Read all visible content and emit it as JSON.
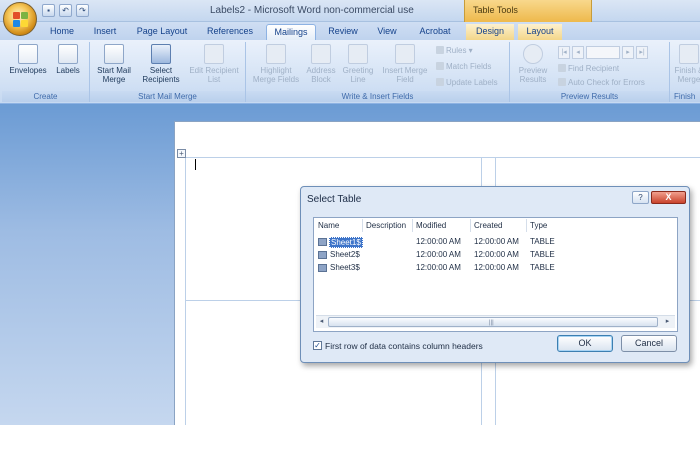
{
  "window": {
    "title": "Labels2 - Microsoft Word non-commercial use",
    "context_tools": "Table Tools"
  },
  "quick_access": [
    "save-icon",
    "undo-icon",
    "redo-icon"
  ],
  "tabs": [
    {
      "label": "Home"
    },
    {
      "label": "Insert"
    },
    {
      "label": "Page Layout"
    },
    {
      "label": "References"
    },
    {
      "label": "Mailings",
      "active": true
    },
    {
      "label": "Review"
    },
    {
      "label": "View"
    },
    {
      "label": "Acrobat"
    },
    {
      "label": "Design"
    },
    {
      "label": "Layout"
    }
  ],
  "ribbon": {
    "create": {
      "label": "Create",
      "envelopes": "Envelopes",
      "labels": "Labels"
    },
    "start_mail_merge": {
      "label": "Start Mail Merge",
      "start": "Start Mail Merge",
      "select_recipients": "Select Recipients",
      "edit_recipient_list": "Edit Recipient List"
    },
    "write_insert": {
      "label": "Write & Insert Fields",
      "highlight": "Highlight Merge Fields",
      "address_block": "Address Block",
      "greeting_line": "Greeting Line",
      "insert_merge_field": "Insert Merge Field",
      "rules": "Rules",
      "match_fields": "Match Fields",
      "update_labels": "Update Labels"
    },
    "preview": {
      "label": "Preview Results",
      "preview_results": "Preview Results",
      "find_recipient": "Find Recipient",
      "auto_check": "Auto Check for Errors"
    },
    "finish": {
      "label": "Finish",
      "finish_merge": "Finish & Merge"
    }
  },
  "dialog": {
    "title": "Select Table",
    "help": "?",
    "close": "X",
    "columns": [
      "Name",
      "Description",
      "Modified",
      "Created",
      "Type"
    ],
    "rows": [
      {
        "name": "Sheet1$",
        "description": "",
        "modified": "12:00:00 AM",
        "created": "12:00:00 AM",
        "type": "TABLE",
        "selected": true
      },
      {
        "name": "Sheet2$",
        "description": "",
        "modified": "12:00:00 AM",
        "created": "12:00:00 AM",
        "type": "TABLE"
      },
      {
        "name": "Sheet3$",
        "description": "",
        "modified": "12:00:00 AM",
        "created": "12:00:00 AM",
        "type": "TABLE"
      }
    ],
    "first_row_headers": {
      "label": "First row of data contains column headers",
      "checked": true
    },
    "ok": "OK",
    "cancel": "Cancel"
  }
}
